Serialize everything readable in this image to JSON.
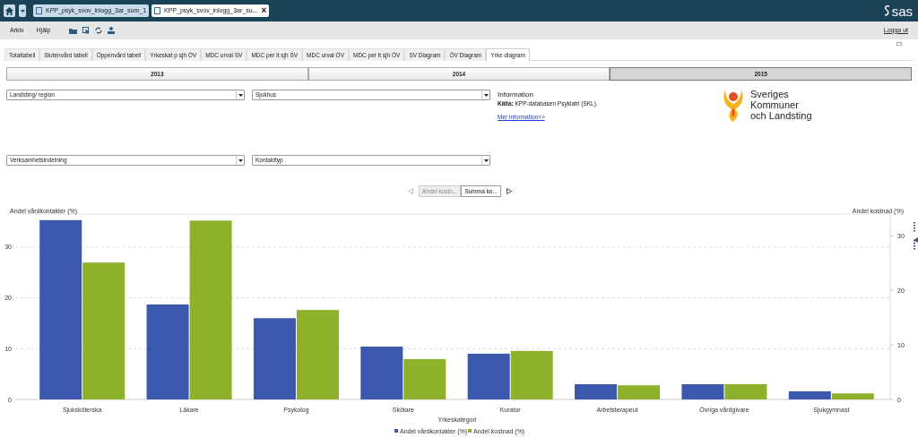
{
  "app_bar": {
    "tabs": [
      {
        "label": "KPP_psyk_svov_inlogg_3ar_sum_1",
        "selected": false,
        "closable": false
      },
      {
        "label": "KPP_psyk_svov_inlogg_3ar_su...",
        "selected": true,
        "closable": true
      }
    ],
    "close_glyph": "×",
    "brand": "sas"
  },
  "menu_bar": {
    "menus": [
      "Arkiv",
      "Hjälp"
    ],
    "logout": "Logga ut"
  },
  "report_tabs": [
    {
      "label": "Totaltabell",
      "selected": false
    },
    {
      "label": "Slutenvård tabell",
      "selected": false
    },
    {
      "label": "Öppenvård tabell",
      "selected": false
    },
    {
      "label": "Yrkeskat p sjh ÖV",
      "selected": false
    },
    {
      "label": "MDC urval SV",
      "selected": false
    },
    {
      "label": "MDC per lt sjh SV",
      "selected": false
    },
    {
      "label": "MDC urval ÖV",
      "selected": false
    },
    {
      "label": "MDC per lt sjh ÖV",
      "selected": false
    },
    {
      "label": "SV Diagram",
      "selected": false
    },
    {
      "label": "ÖV Diagram",
      "selected": false
    },
    {
      "label": "Yrke diagram",
      "selected": true
    }
  ],
  "years": [
    {
      "label": "2013",
      "selected": false
    },
    {
      "label": "2014",
      "selected": false
    },
    {
      "label": "2015",
      "selected": true
    }
  ],
  "filters": [
    {
      "value": "Landsting/ region"
    },
    {
      "value": "Sjukhus"
    },
    {
      "value": "Verksamhetsindelning"
    },
    {
      "value": "Kontakttyp"
    }
  ],
  "information": {
    "title": "Information",
    "source": "**Källa:** KPP-databasen Psykiatri (SKL).",
    "link": "Mer information>>"
  },
  "logo": {
    "lines": [
      "Sveriges",
      "Kommuner",
      "och Landsting"
    ]
  },
  "pager": {
    "items": [
      {
        "label": "Andel kostn...",
        "selected": false
      },
      {
        "label": "Summa ko...",
        "selected": true
      }
    ]
  },
  "chart": {
    "chart_data": {
      "type": "bar",
      "xlabel": "Yrkeskategori",
      "ylabel": "Andel vårdkontakter (%)",
      "y2label": "Andel kostnad (%)",
      "categories": [
        "Sjuksköterska",
        "Läkare",
        "Psykolog",
        "Skötare",
        "Kurator",
        "Arbetsterapeut",
        "Övriga vårdgivare",
        "Sjukgymnast"
      ],
      "series": [
        {
          "name": "Andel vårdkontakter (%)",
          "color": "#3c58ad",
          "values": [
            35.3,
            18.7,
            16.0,
            10.4,
            9.0,
            3.0,
            3.0,
            1.6
          ]
        },
        {
          "name": "Andel kostnad (%)",
          "color": "#8db12a",
          "axis": "y2",
          "values": [
            25.1,
            32.8,
            16.4,
            7.4,
            8.9,
            2.6,
            2.8,
            1.1
          ]
        }
      ],
      "ylim": [
        0,
        36.5
      ],
      "yticks": [
        0,
        10,
        20,
        30
      ],
      "y2lim": [
        0,
        34
      ],
      "grid": true,
      "legend": "bottom",
      "y2ticks": [
        0,
        10,
        20,
        30
      ]
    }
  }
}
